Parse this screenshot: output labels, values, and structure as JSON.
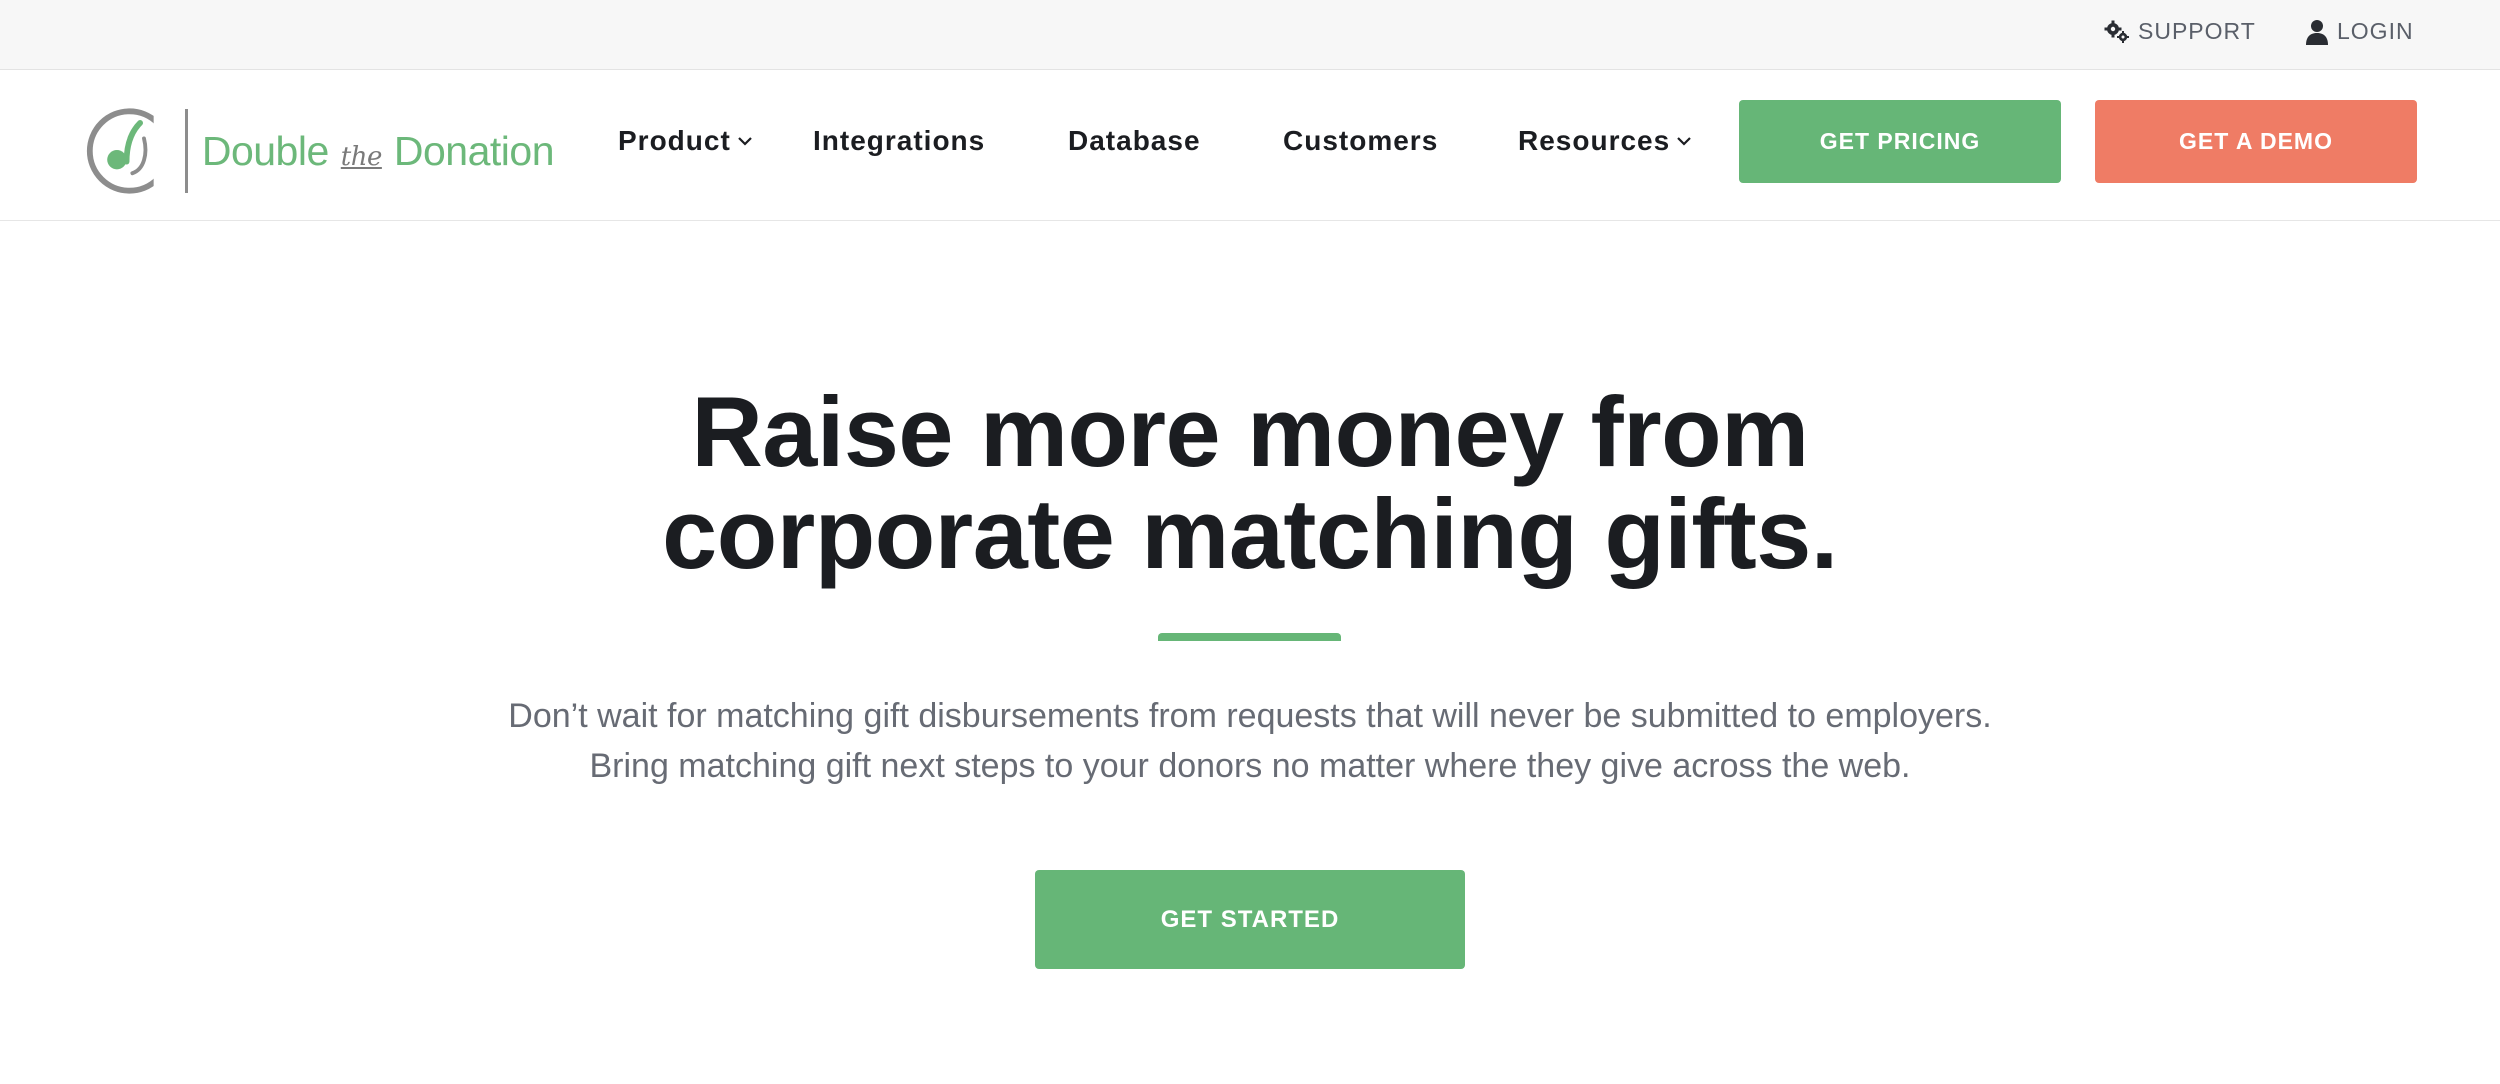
{
  "utility_bar": {
    "support_label": "SUPPORT",
    "support_icon": "gears-icon",
    "login_label": "LOGIN",
    "login_icon": "user-icon"
  },
  "brand": {
    "logo_word_1": "Double",
    "logo_word_the": "the",
    "logo_word_2": "Donation",
    "brand_green": "#6cb87a",
    "mark_gray": "#8d8d8d"
  },
  "nav": {
    "items": [
      {
        "label": "Product",
        "has_dropdown": true
      },
      {
        "label": "Integrations",
        "has_dropdown": false
      },
      {
        "label": "Database",
        "has_dropdown": false
      },
      {
        "label": "Customers",
        "has_dropdown": false
      },
      {
        "label": "Resources",
        "has_dropdown": true
      }
    ],
    "pricing_label": "GET PRICING",
    "demo_label": "GET A DEMO",
    "pricing_color": "#66b677",
    "demo_color": "#ef7c65"
  },
  "hero": {
    "title_line_1": "Raise more money from",
    "title_line_2": "corporate matching gifts.",
    "subtitle_line_1": "Don’t wait for matching gift disbursements from requests that will never be submitted to employers.",
    "subtitle_line_2": "Bring matching gift next steps to your donors no matter where they give across the web.",
    "cta_label": "GET STARTED",
    "accent_color": "#66b677"
  }
}
